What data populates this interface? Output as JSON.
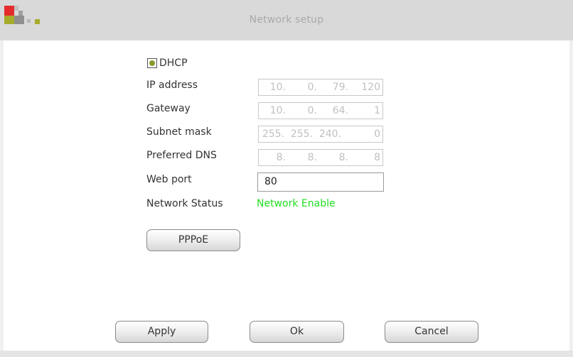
{
  "window": {
    "title": "Network setup"
  },
  "dhcp": {
    "label": "DHCP",
    "checked": true
  },
  "fields": {
    "ip_address": {
      "label": "IP address",
      "octets": [
        "10.",
        "0.",
        "79.",
        "120"
      ]
    },
    "gateway": {
      "label": "Gateway",
      "octets": [
        "10.",
        "0.",
        "64.",
        "1"
      ]
    },
    "subnet_mask": {
      "label": "Subnet mask",
      "octets": [
        "255.",
        "255.",
        "240.",
        "0"
      ]
    },
    "preferred_dns": {
      "label": "Preferred DNS",
      "octets": [
        "8.",
        "8.",
        "8.",
        "8"
      ]
    },
    "web_port": {
      "label": "Web port",
      "value": "80"
    },
    "network_status": {
      "label": "Network Status",
      "value": "Network Enable"
    }
  },
  "buttons": {
    "pppoe": "PPPoE",
    "apply": "Apply",
    "ok": "Ok",
    "cancel": "Cancel"
  },
  "colors": {
    "titlebar": "#d9d9d9",
    "status_ok": "#22dd22",
    "dhcp_dot": "#8a9a2a",
    "logo_red": "#e52c2c",
    "logo_olive": "#a6ab2b"
  }
}
